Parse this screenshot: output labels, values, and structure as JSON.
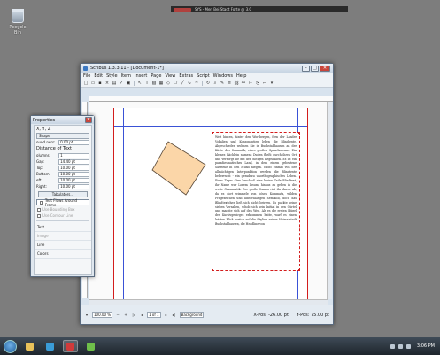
{
  "desktop": {
    "icons": [
      {
        "label": "Recycle Bin",
        "icon": "recycle-bin-icon"
      }
    ],
    "top_strip_text": "SYS - Men Bei Stadt Forte @ 3.0"
  },
  "window": {
    "title": "Scribus 1.3.3.11 - [Document-1*]",
    "controls": {
      "minimize": "–",
      "maximize": "□",
      "close": "✕"
    },
    "menu": [
      "File",
      "Edit",
      "Style",
      "Item",
      "Insert",
      "Page",
      "View",
      "Extras",
      "Script",
      "Windows",
      "Help"
    ],
    "toolbar_icons": [
      "new-icon",
      "open-icon",
      "save-icon",
      "close-doc-icon",
      "print-icon",
      "preflight-icon",
      "pdf-icon",
      "select-icon",
      "text-frame-icon",
      "image-frame-icon",
      "table-icon",
      "shape-icon",
      "polygon-icon",
      "line-icon",
      "bezier-icon",
      "freehand-icon",
      "rotate-icon",
      "zoom-icon",
      "edit-content-icon",
      "edit-text-icon",
      "link-frames-icon",
      "unlink-frames-icon",
      "measure-icon",
      "copy-properties-icon",
      "eyedropper-icon",
      "pdf-tools-icon"
    ],
    "frame_text": "Weit hinten, hinter den Wortbergen, fern der Länder Vokalien und Konsonantien leben die Blindtexte. Abgeschieden wohnen Sie in Buchstabhausen an der Küste des Semantik, eines großen Sprachozeans. Ein kleines Bächlein namens Duden fließt durch ihren Ort und versorgt sie mit den nötigen Regelialien. Es ist ein paradiesmatisches Land, in dem einem gebratene Satzteile in den Mund fliegen. Nicht einmal von der allmächtigen Interpunktion werden die Blindtexte beherrscht - ein geradezu unorthographisches Leben. Eines Tages aber beschloß eine kleine Zeile Blindtext, ihr Name war Lorem Ipsum, hinaus zu gehen in die weite Grammatik. Der große Oxmox riet ihr davon ab, da es dort wimmele von bösen Kommata, wilden Fragezeichen und hinterhältigen Semikoli, doch das Blindtextchen ließ sich nicht beirren. Es packte seine sieben Versalien, schob sich sein Initial in den Gürtel und machte sich auf den Weg. Als es die ersten Hügel des Kursivgebirges erklommen hatte, warf es einen letzten Blick zurück auf die Skyline seiner Heimatstadt Buchstabhausen, die Headline von",
    "status": {
      "zoom": "100.00 %",
      "page": "1 of 1",
      "layer": "Background",
      "x_pos": "X-Pos: -26.00 pt",
      "y_pos": "Y-Pos: 75.00 pt"
    }
  },
  "properties": {
    "title": "Properties",
    "tabs": [
      "X, Y, Z",
      "Shape"
    ],
    "fields": [
      {
        "label": "ound ners:",
        "value": "0.00 pt"
      },
      {
        "label": "Tabs:",
        "value": ""
      },
      {
        "label": "olumns:",
        "value": "1"
      },
      {
        "label": "Gap:",
        "value": "14.40 pt"
      },
      {
        "label": "Top:",
        "value": "10.00 pt"
      },
      {
        "label": "Bottom:",
        "value": "10.00 pt"
      },
      {
        "label": "eft:",
        "value": "10.00 pt"
      },
      {
        "label": "Right:",
        "value": "10.00 pt"
      }
    ],
    "distance_label": "Distance of Text",
    "tabulators_button": "Tabulators...",
    "checks": [
      {
        "label": "Text Flows Around Frame",
        "enabled": true
      },
      {
        "label": "Use Bounding Box",
        "enabled": false
      },
      {
        "label": "Use Contour Line",
        "enabled": false
      }
    ],
    "groups": [
      {
        "label": "Text",
        "enabled": true
      },
      {
        "label": "Image",
        "enabled": false
      },
      {
        "label": "Line",
        "enabled": true
      },
      {
        "label": "Colors",
        "enabled": true
      }
    ]
  },
  "taskbar": {
    "apps": [
      {
        "icon": "explorer-icon",
        "color": "#e8c15a",
        "active": false
      },
      {
        "icon": "media-player-icon",
        "color": "#3a9cd8",
        "active": false
      },
      {
        "icon": "scribus-icon",
        "color": "#d03a3a",
        "active": true
      },
      {
        "icon": "paint-icon",
        "color": "#6fbf4a",
        "active": false
      }
    ],
    "clock": "3:06 PM"
  },
  "colors": {
    "diamond_fill": "#fbd6a8",
    "diamond_stroke": "#5a4a3a",
    "guide": "#3a52d6",
    "frame_border": "#d31d1d"
  }
}
